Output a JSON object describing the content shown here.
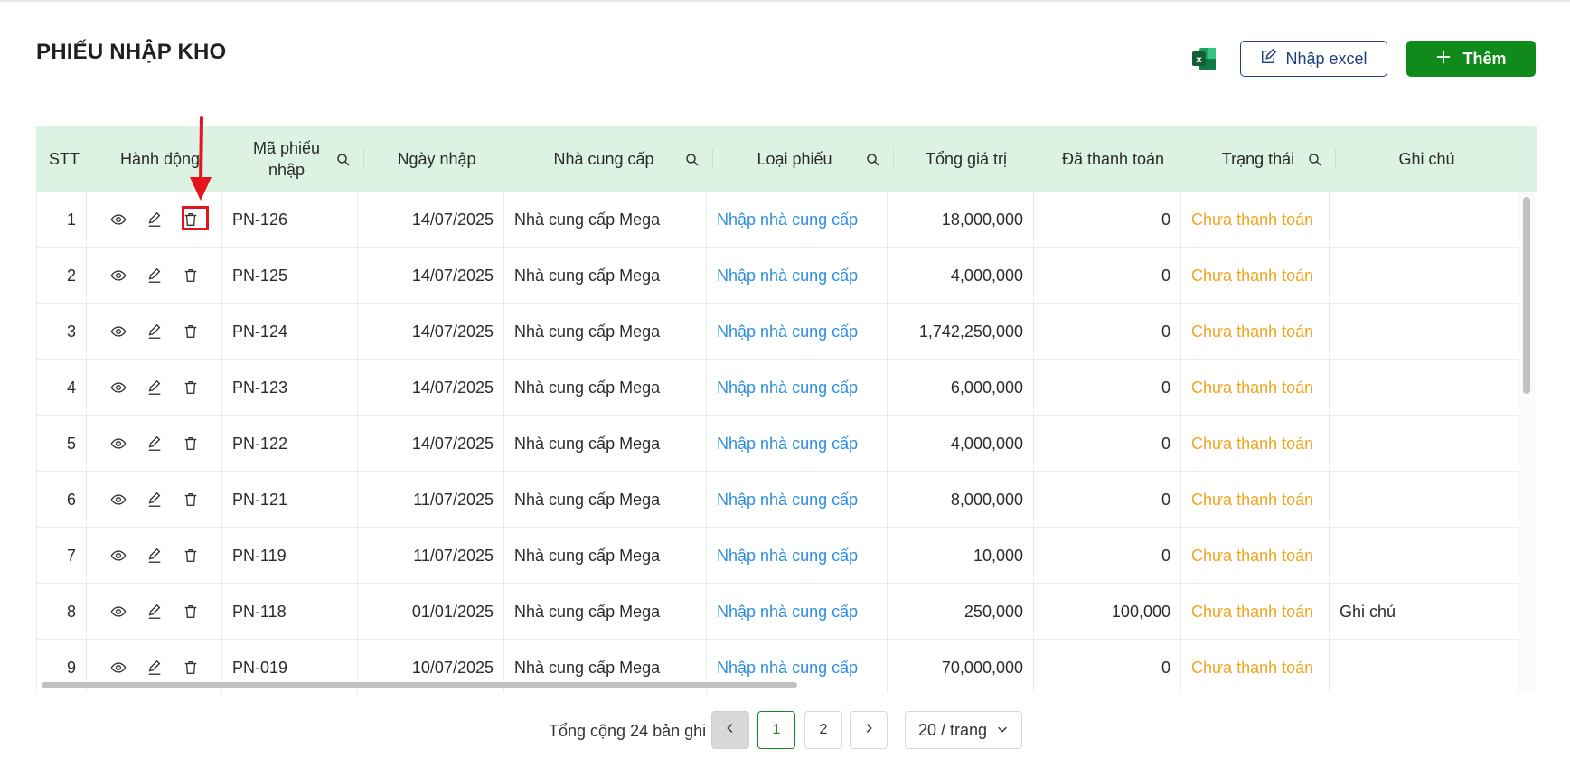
{
  "page": {
    "title": "PHIẾU NHẬP KHO"
  },
  "toolbar": {
    "excel_icon": "excel-icon",
    "import_label": "Nhập excel",
    "add_label": "Thêm",
    "accent": "#0f8a1b",
    "import_color": "#1d3f7a"
  },
  "table": {
    "headers": {
      "stt": "STT",
      "actions": "Hành động",
      "code_line1": "Mã phiếu",
      "code_line2": "nhập",
      "date": "Ngày nhập",
      "supplier": "Nhà cung cấp",
      "type": "Loại phiếu",
      "total": "Tổng giá trị",
      "paid": "Đã thanh toán",
      "status": "Trạng thái",
      "note": "Ghi chú"
    },
    "rows": [
      {
        "stt": "1",
        "code": "PN-126",
        "date": "14/07/2025",
        "supplier": "Nhà cung cấp Mega",
        "type": "Nhập nhà cung cấp",
        "total": "18,000,000",
        "paid": "0",
        "status": "Chưa thanh toán",
        "note": ""
      },
      {
        "stt": "2",
        "code": "PN-125",
        "date": "14/07/2025",
        "supplier": "Nhà cung cấp Mega",
        "type": "Nhập nhà cung cấp",
        "total": "4,000,000",
        "paid": "0",
        "status": "Chưa thanh toán",
        "note": ""
      },
      {
        "stt": "3",
        "code": "PN-124",
        "date": "14/07/2025",
        "supplier": "Nhà cung cấp Mega",
        "type": "Nhập nhà cung cấp",
        "total": "1,742,250,000",
        "paid": "0",
        "status": "Chưa thanh toán",
        "note": ""
      },
      {
        "stt": "4",
        "code": "PN-123",
        "date": "14/07/2025",
        "supplier": "Nhà cung cấp Mega",
        "type": "Nhập nhà cung cấp",
        "total": "6,000,000",
        "paid": "0",
        "status": "Chưa thanh toán",
        "note": ""
      },
      {
        "stt": "5",
        "code": "PN-122",
        "date": "14/07/2025",
        "supplier": "Nhà cung cấp Mega",
        "type": "Nhập nhà cung cấp",
        "total": "4,000,000",
        "paid": "0",
        "status": "Chưa thanh toán",
        "note": ""
      },
      {
        "stt": "6",
        "code": "PN-121",
        "date": "11/07/2025",
        "supplier": "Nhà cung cấp Mega",
        "type": "Nhập nhà cung cấp",
        "total": "8,000,000",
        "paid": "0",
        "status": "Chưa thanh toán",
        "note": ""
      },
      {
        "stt": "7",
        "code": "PN-119",
        "date": "11/07/2025",
        "supplier": "Nhà cung cấp Mega",
        "type": "Nhập nhà cung cấp",
        "total": "10,000",
        "paid": "0",
        "status": "Chưa thanh toán",
        "note": ""
      },
      {
        "stt": "8",
        "code": "PN-118",
        "date": "01/01/2025",
        "supplier": "Nhà cung cấp Mega",
        "type": "Nhập nhà cung cấp",
        "total": "250,000",
        "paid": "100,000",
        "status": "Chưa thanh toán",
        "note": "Ghi chú"
      },
      {
        "stt": "9",
        "code": "PN-019",
        "date": "10/07/2025",
        "supplier": "Nhà cung cấp Mega",
        "type": "Nhập nhà cung cấp",
        "total": "70,000,000",
        "paid": "0",
        "status": "Chưa thanh toán",
        "note": ""
      }
    ],
    "colors": {
      "header_bg": "#dcf3e4",
      "link": "#2d8ee3",
      "status": "#f2a51f"
    }
  },
  "pagination": {
    "total_text": "Tổng cộng 24 bản ghi",
    "pages": [
      "1",
      "2"
    ],
    "current_page": "1",
    "page_size": "20 / trang"
  },
  "annotation": {
    "highlight_color": "#e8141b",
    "target": "delete-icon row 1"
  }
}
